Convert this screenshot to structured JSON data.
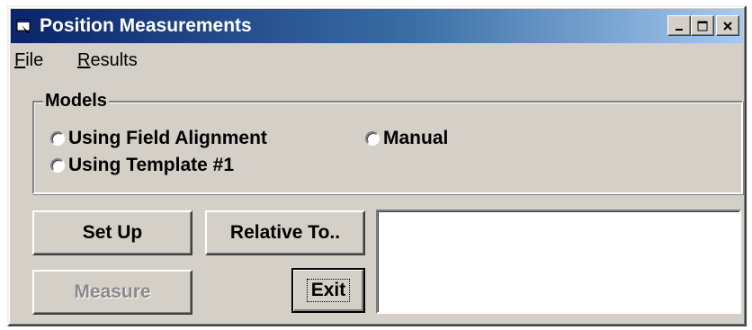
{
  "window": {
    "title": "Position Measurements",
    "minimize_label": "_",
    "maximize_label": "□",
    "close_label": "×"
  },
  "menu": {
    "file": {
      "mnemonic": "F",
      "rest": "ile"
    },
    "results": {
      "mnemonic": "R",
      "rest": "esults"
    }
  },
  "models": {
    "legend": "Models",
    "options": [
      {
        "label": "Using Field Alignment",
        "selected": false
      },
      {
        "label": "Manual",
        "selected": false
      },
      {
        "label": "Using Template #1",
        "selected": false
      }
    ]
  },
  "buttons": {
    "setup": "Set Up",
    "relative_to": "Relative To..",
    "measure": "Measure",
    "exit": "Exit"
  },
  "output": {
    "text": ""
  },
  "colors": {
    "face": "#d4d0c8",
    "titlebar_start": "#0a246a",
    "titlebar_end": "#a6caf0",
    "disabled_text": "#8a8a8a"
  }
}
